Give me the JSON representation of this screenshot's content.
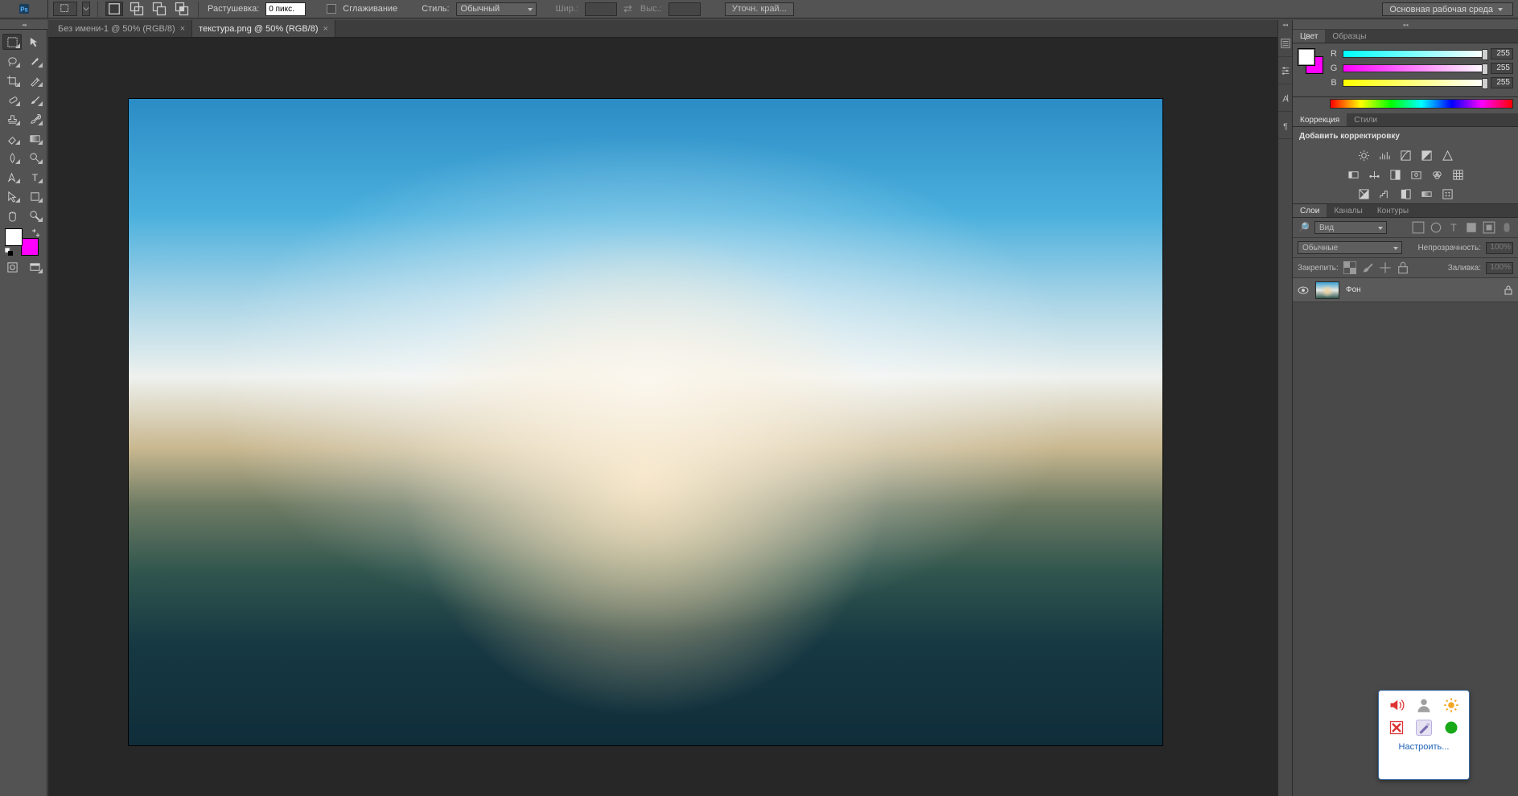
{
  "workspace_label": "Основная рабочая среда",
  "optionbar": {
    "feather_label": "Растушевка:",
    "feather_value": "0 пикс.",
    "antialias_label": "Сглаживание",
    "style_label": "Стиль:",
    "style_value": "Обычный",
    "width_label": "Шир.:",
    "height_label": "Выс.:",
    "refine_label": "Уточн. край..."
  },
  "doc_tabs": [
    {
      "title": "Без имени-1 @ 50% (RGB/8)",
      "active": false
    },
    {
      "title": "текстура.png @ 50% (RGB/8)",
      "active": true
    }
  ],
  "panels": {
    "color_tabs": [
      "Цвет",
      "Образцы"
    ],
    "color_values": {
      "r_label": "R",
      "g_label": "G",
      "b_label": "B",
      "r": "255",
      "g": "255",
      "b": "255"
    },
    "adjust_tabs": [
      "Коррекция",
      "Стили"
    ],
    "adjust_header": "Добавить корректировку",
    "layers_tabs": [
      "Слои",
      "Каналы",
      "Контуры"
    ],
    "layers_filter_label": "Вид",
    "blend_mode": "Обычные",
    "opacity_label": "Непрозрачность:",
    "opacity_value": "100%",
    "lock_label": "Закрепить:",
    "fill_label": "Заливка:",
    "fill_value": "100%",
    "layer_name": "Фон"
  },
  "tray": {
    "configure": "Настроить..."
  }
}
